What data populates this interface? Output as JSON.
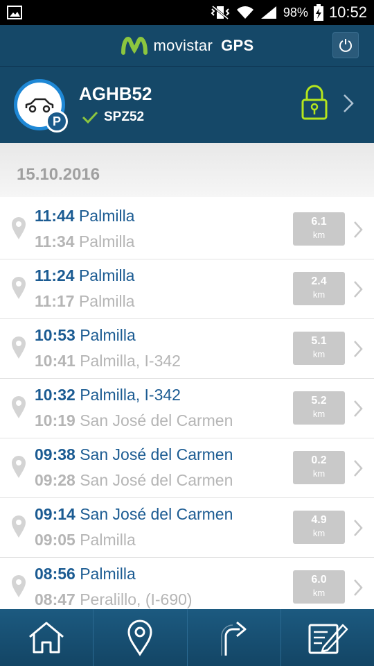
{
  "status": {
    "battery": "98%",
    "time": "10:52"
  },
  "app": {
    "brand": "movistar",
    "product": "GPS"
  },
  "vehicle": {
    "plate": "AGHB52",
    "secondary": "SPZ52",
    "parking_badge": "P"
  },
  "date": "15.10.2016",
  "trips": [
    {
      "end_time": "11:44",
      "end_place": "Palmilla",
      "start_time": "11:34",
      "start_place": "Palmilla",
      "km": "6.1",
      "unit": "km"
    },
    {
      "end_time": "11:24",
      "end_place": "Palmilla",
      "start_time": "11:17",
      "start_place": "Palmilla",
      "km": "2.4",
      "unit": "km"
    },
    {
      "end_time": "10:53",
      "end_place": "Palmilla",
      "start_time": "10:41",
      "start_place": "Palmilla, I-342",
      "km": "5.1",
      "unit": "km"
    },
    {
      "end_time": "10:32",
      "end_place": "Palmilla, I-342",
      "start_time": "10:19",
      "start_place": "San José del Carmen",
      "km": "5.2",
      "unit": "km"
    },
    {
      "end_time": "09:38",
      "end_place": "San José del Carmen",
      "start_time": "09:28",
      "start_place": "San José del Carmen",
      "km": "0.2",
      "unit": "km"
    },
    {
      "end_time": "09:14",
      "end_place": "San José del Carmen",
      "start_time": "09:05",
      "start_place": "Palmilla",
      "km": "4.9",
      "unit": "km"
    },
    {
      "end_time": "08:56",
      "end_place": "Palmilla",
      "start_time": "08:47",
      "start_place": "Peralillo, (I-690)",
      "km": "6.0",
      "unit": "km"
    }
  ],
  "icons": {
    "lock": "padlock-icon",
    "nav": [
      "home-icon",
      "location-pin-icon",
      "turn-right-icon",
      "notepad-icon"
    ]
  },
  "colors": {
    "header": "#154868",
    "accent_blue": "#1b5b92",
    "lock_green": "#b5e61d"
  }
}
